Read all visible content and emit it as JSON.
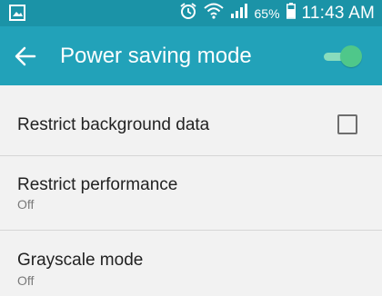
{
  "status_bar": {
    "battery_percent": "65%",
    "time": "11:43 AM",
    "icons": [
      "gallery-icon",
      "alarm-icon",
      "wifi-icon",
      "signal-icon",
      "battery-icon"
    ]
  },
  "app_bar": {
    "title": "Power saving mode",
    "switch_on": true,
    "back_icon": "back-arrow-icon"
  },
  "settings": [
    {
      "title": "Restrict background data",
      "checked": false
    },
    {
      "title": "Restrict performance",
      "subtitle": "Off"
    },
    {
      "title": "Grayscale mode",
      "subtitle": "Off"
    }
  ],
  "colors": {
    "status_bar": "#1b93a7",
    "app_bar": "#22a2b9",
    "switch_thumb": "#4fc78a",
    "switch_track": "#88dcbd",
    "background": "#f2f2f2"
  }
}
